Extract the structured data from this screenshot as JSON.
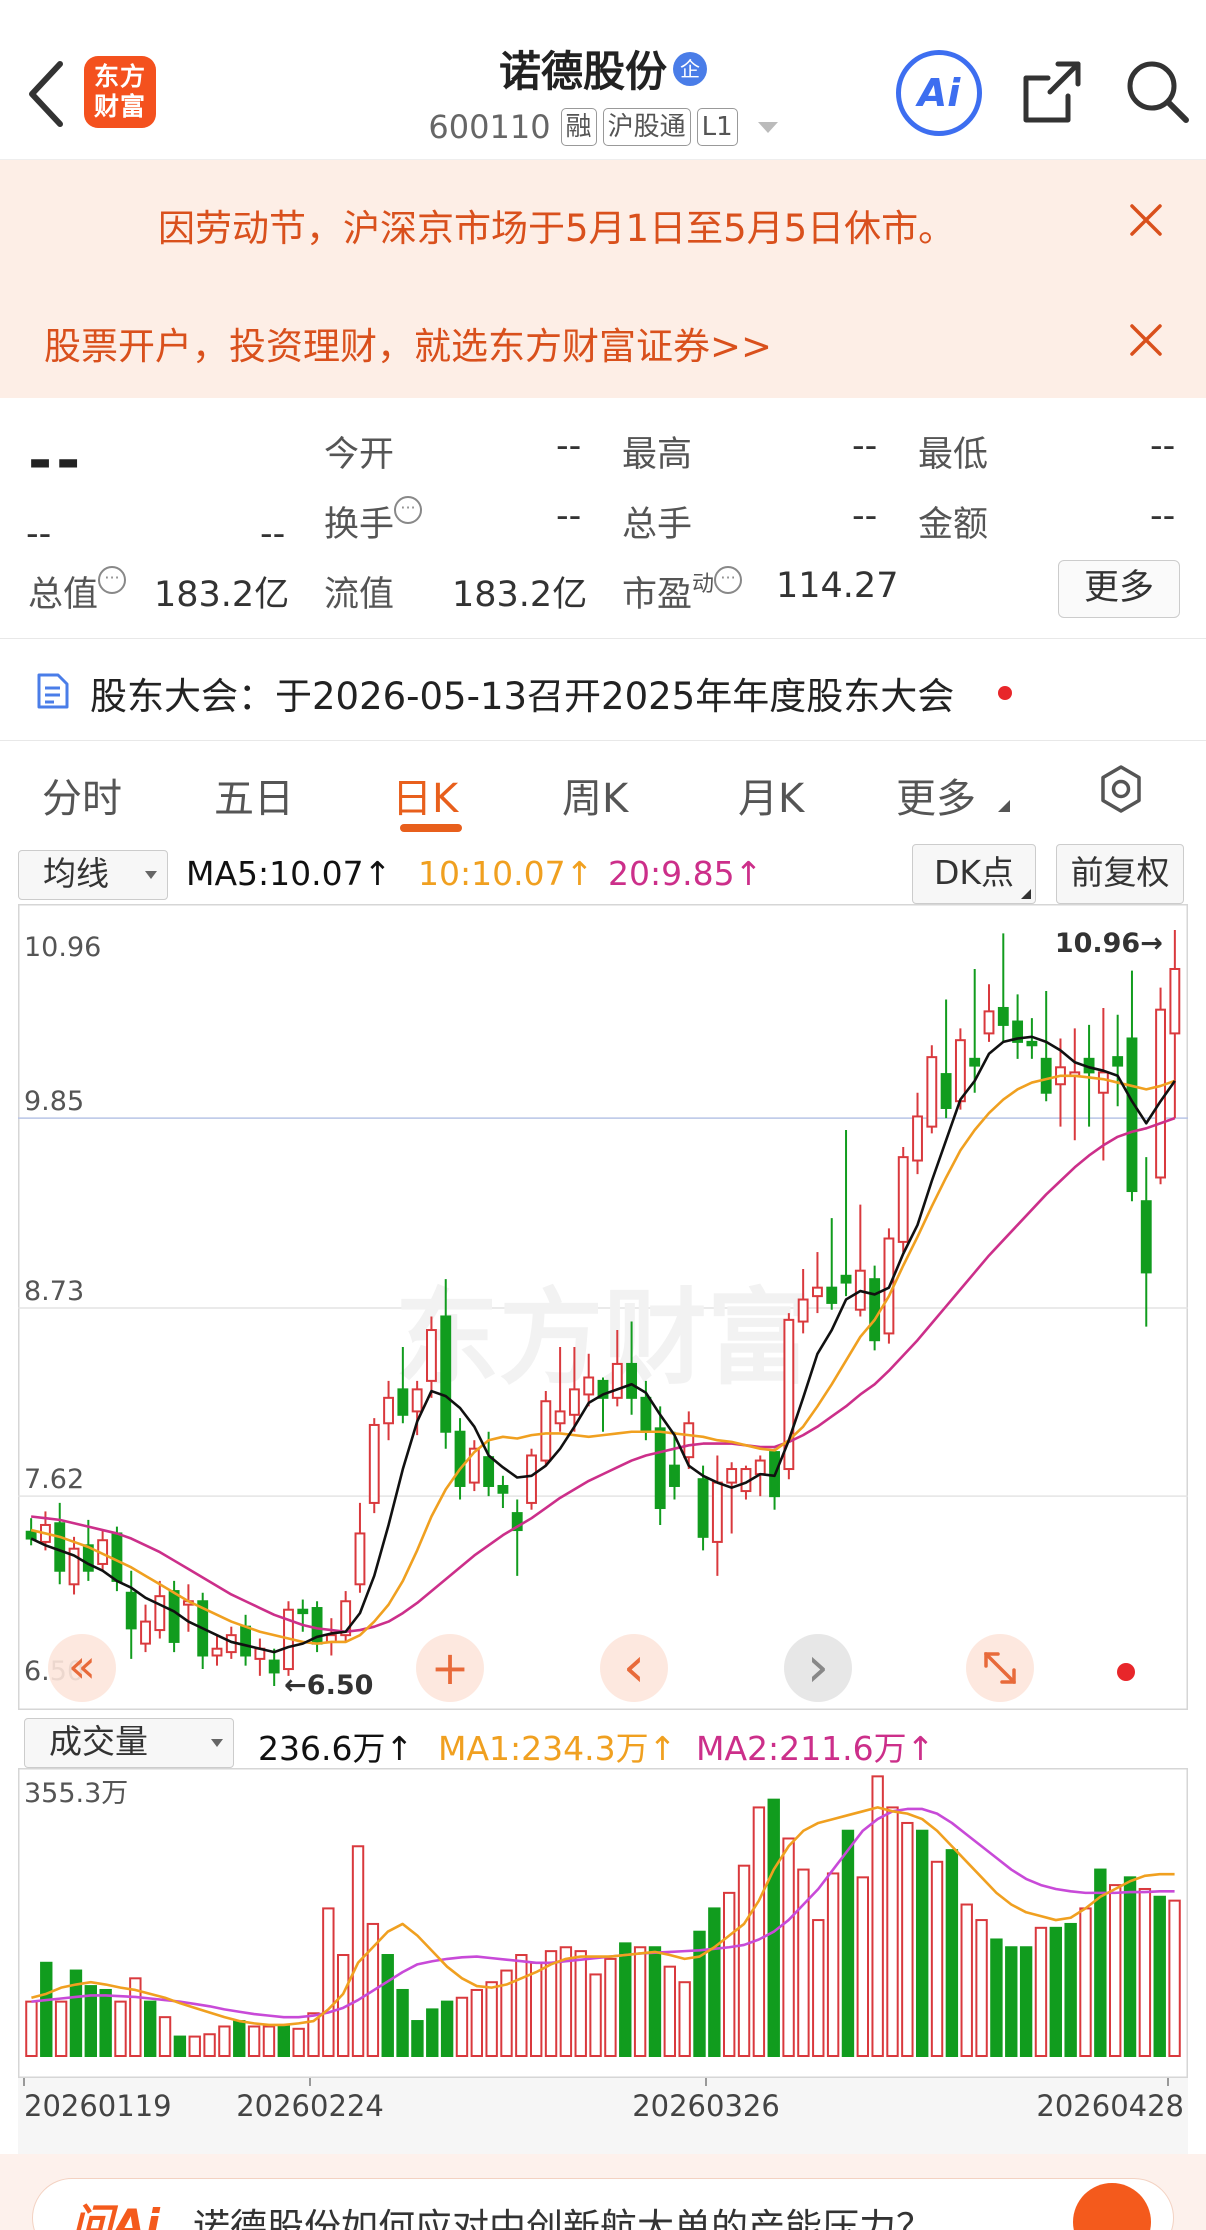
{
  "header": {
    "logo_text_1": "东方",
    "logo_text_2": "财富",
    "title": "诺德股份",
    "title_badge": "企",
    "code": "600110",
    "tags": [
      "融",
      "沪股通",
      "L1"
    ],
    "ai_label": "Ai"
  },
  "notices": [
    {
      "text": "因劳动节，沪深京市场于5月1日至5月5日休市。"
    },
    {
      "text": "股票开户，投资理财，就选东方财富证券>>"
    }
  ],
  "quote": {
    "price": "--",
    "change": "--",
    "change_pct": "--",
    "open_label": "今开",
    "open": "--",
    "high_label": "最高",
    "high": "--",
    "low_label": "最低",
    "low": "--",
    "turnover_label": "换手",
    "turnover": "--",
    "volume_label": "总手",
    "volume": "--",
    "amount_label": "金额",
    "amount": "--",
    "mktcap_label": "总值",
    "mktcap": "183.2亿",
    "float_label": "流值",
    "float_cap": "183.2亿",
    "pe_label": "市盈",
    "pe_sup": "动",
    "pe": "114.27",
    "more_label": "更多"
  },
  "meeting": {
    "text": "股东大会：于2026-05-13召开2025年年度股东大会"
  },
  "tabs": [
    "分时",
    "五日",
    "日K",
    "周K",
    "月K",
    "更多"
  ],
  "active_tab": "日K",
  "chart_controls": {
    "ma_selector": "均线",
    "ma5": "MA5:10.07",
    "ma10": "10:10.07",
    "ma20": "20:9.85",
    "dk_label": "DK点",
    "adjust_label": "前复权",
    "vol_selector": "成交量",
    "vol_value": "236.6万",
    "vol_ma1": "MA1:234.3万",
    "vol_ma2": "MA2:211.6万",
    "arrow_up": "↑"
  },
  "colors": {
    "up": "#d9393d",
    "down": "#119c1e",
    "ma5": "#111111",
    "ma10": "#f0a020",
    "ma20": "#cc2f8a",
    "accent": "#e85f1c"
  },
  "chart_data": [
    {
      "type": "candlestick",
      "title": "",
      "y_ticks": [
        "10.96",
        "9.85",
        "8.73",
        "7.62",
        "6.50"
      ],
      "ylim": [
        6.5,
        10.96
      ],
      "high_marker": "10.96→",
      "low_marker": "←6.50",
      "candles": [
        [
          7.41,
          7.37,
          7.49,
          7.33
        ],
        [
          7.35,
          7.45,
          7.53,
          7.3
        ],
        [
          7.46,
          7.18,
          7.58,
          7.1
        ],
        [
          7.1,
          7.31,
          7.38,
          7.04
        ],
        [
          7.33,
          7.18,
          7.48,
          7.12
        ],
        [
          7.22,
          7.36,
          7.42,
          7.18
        ],
        [
          7.4,
          7.12,
          7.44,
          7.06
        ],
        [
          7.05,
          6.84,
          7.18,
          6.66
        ],
        [
          6.75,
          6.88,
          6.98,
          6.7
        ],
        [
          6.83,
          7.03,
          7.12,
          6.78
        ],
        [
          7.06,
          6.76,
          7.12,
          6.7
        ],
        [
          6.98,
          7.0,
          7.1,
          6.82
        ],
        [
          7.0,
          6.68,
          7.05,
          6.6
        ],
        [
          6.68,
          6.72,
          6.8,
          6.62
        ],
        [
          6.7,
          6.8,
          6.85,
          6.66
        ],
        [
          6.85,
          6.68,
          6.92,
          6.62
        ],
        [
          6.66,
          6.72,
          6.78,
          6.56
        ],
        [
          6.65,
          6.58,
          6.72,
          6.5
        ],
        [
          6.6,
          6.95,
          7.0,
          6.56
        ],
        [
          6.95,
          6.93,
          7.01,
          6.82
        ],
        [
          6.96,
          6.75,
          7.0,
          6.7
        ],
        [
          6.76,
          6.8,
          6.9,
          6.68
        ],
        [
          6.8,
          7.0,
          7.06,
          6.76
        ],
        [
          7.1,
          7.4,
          7.58,
          7.05
        ],
        [
          7.58,
          8.04,
          8.08,
          7.52
        ],
        [
          8.05,
          8.2,
          8.3,
          7.95
        ],
        [
          8.25,
          8.1,
          8.5,
          8.05
        ],
        [
          8.12,
          8.25,
          8.3,
          7.98
        ],
        [
          8.3,
          8.6,
          8.68,
          8.2
        ],
        [
          8.68,
          8.0,
          8.9,
          7.9
        ],
        [
          8.0,
          7.68,
          8.08,
          7.6
        ],
        [
          7.7,
          7.9,
          7.95,
          7.65
        ],
        [
          7.85,
          7.68,
          8.0,
          7.62
        ],
        [
          7.68,
          7.64,
          7.74,
          7.55
        ],
        [
          7.52,
          7.42,
          7.6,
          7.15
        ],
        [
          7.58,
          7.86,
          7.9,
          7.54
        ],
        [
          7.83,
          8.18,
          8.24,
          7.8
        ],
        [
          8.05,
          8.12,
          8.5,
          8.0
        ],
        [
          8.1,
          8.25,
          8.5,
          8.0
        ],
        [
          8.22,
          8.32,
          8.46,
          8.15
        ],
        [
          8.3,
          8.2,
          8.32,
          8.0
        ],
        [
          8.2,
          8.4,
          8.6,
          8.15
        ],
        [
          8.4,
          8.2,
          8.65,
          8.1
        ],
        [
          8.2,
          8.0,
          8.3,
          7.95
        ],
        [
          8.02,
          7.55,
          8.15,
          7.45
        ],
        [
          7.8,
          7.68,
          8.0,
          7.6
        ],
        [
          7.85,
          8.05,
          8.12,
          7.78
        ],
        [
          7.72,
          7.38,
          7.8,
          7.3
        ],
        [
          7.35,
          7.7,
          7.86,
          7.15
        ],
        [
          7.7,
          7.78,
          7.82,
          7.4
        ],
        [
          7.65,
          7.78,
          7.8,
          7.6
        ],
        [
          7.75,
          7.83,
          7.86,
          7.62
        ],
        [
          7.88,
          7.62,
          7.9,
          7.54
        ],
        [
          7.78,
          8.66,
          8.7,
          7.72
        ],
        [
          8.65,
          8.78,
          8.96,
          8.58
        ],
        [
          8.8,
          8.85,
          9.06,
          8.7
        ],
        [
          8.85,
          8.76,
          9.26,
          8.72
        ],
        [
          8.92,
          8.88,
          9.78,
          8.8
        ],
        [
          8.72,
          8.95,
          9.34,
          8.68
        ],
        [
          8.9,
          8.54,
          8.98,
          8.48
        ],
        [
          8.58,
          9.14,
          9.2,
          8.52
        ],
        [
          9.12,
          9.62,
          9.68,
          9.06
        ],
        [
          9.6,
          9.86,
          10.0,
          9.52
        ],
        [
          9.8,
          10.21,
          10.28,
          9.76
        ],
        [
          10.11,
          9.91,
          10.55,
          9.85
        ],
        [
          9.95,
          10.31,
          10.38,
          9.9
        ],
        [
          10.2,
          10.16,
          10.73,
          10.0
        ],
        [
          10.35,
          10.48,
          10.64,
          10.3
        ],
        [
          10.5,
          10.4,
          10.94,
          10.3
        ],
        [
          10.42,
          10.3,
          10.58,
          10.2
        ],
        [
          10.3,
          10.28,
          10.44,
          10.2
        ],
        [
          10.2,
          10.0,
          10.6,
          9.95
        ],
        [
          10.05,
          10.15,
          10.32,
          9.8
        ],
        [
          10.1,
          10.12,
          10.38,
          9.72
        ],
        [
          10.2,
          10.12,
          10.4,
          9.8
        ],
        [
          10.0,
          10.12,
          10.5,
          9.6
        ],
        [
          10.21,
          10.16,
          10.46,
          9.92
        ],
        [
          10.32,
          9.42,
          10.72,
          9.36
        ],
        [
          9.36,
          8.94,
          9.62,
          8.62
        ],
        [
          9.5,
          10.49,
          10.62,
          9.46
        ],
        [
          10.35,
          10.73,
          10.96,
          9.85
        ]
      ],
      "ma5": [
        7.37,
        7.33,
        7.3,
        7.27,
        7.22,
        7.18,
        7.12,
        7.08,
        7.02,
        6.98,
        6.94,
        6.88,
        6.84,
        6.8,
        6.76,
        6.74,
        6.72,
        6.7,
        6.73,
        6.75,
        6.79,
        6.81,
        6.82,
        6.93,
        7.15,
        7.45,
        7.78,
        8.06,
        8.24,
        8.21,
        8.14,
        8.03,
        7.86,
        7.79,
        7.73,
        7.74,
        7.8,
        7.9,
        8.03,
        8.17,
        8.22,
        8.25,
        8.28,
        8.23,
        8.1,
        7.98,
        7.8,
        7.74,
        7.7,
        7.67,
        7.7,
        7.75,
        7.74,
        7.95,
        8.2,
        8.46,
        8.6,
        8.78,
        8.83,
        8.81,
        8.85,
        9.05,
        9.22,
        9.48,
        9.72,
        9.96,
        10.07,
        10.23,
        10.3,
        10.32,
        10.33,
        10.3,
        10.25,
        10.18,
        10.15,
        10.13,
        10.1,
        9.95,
        9.82,
        9.95,
        10.07
      ],
      "ma10": [
        7.42,
        7.4,
        7.38,
        7.35,
        7.32,
        7.28,
        7.24,
        7.2,
        7.15,
        7.1,
        7.05,
        7.0,
        6.96,
        6.92,
        6.88,
        6.85,
        6.82,
        6.8,
        6.78,
        6.76,
        6.75,
        6.76,
        6.76,
        6.8,
        6.88,
        6.98,
        7.12,
        7.3,
        7.5,
        7.66,
        7.78,
        7.88,
        7.95,
        7.97,
        7.96,
        7.98,
        7.99,
        7.99,
        7.98,
        7.97,
        7.98,
        7.99,
        8.0,
        8.0,
        8.0,
        7.99,
        7.98,
        7.97,
        7.95,
        7.94,
        7.92,
        7.9,
        7.89,
        7.95,
        8.03,
        8.15,
        8.28,
        8.42,
        8.56,
        8.66,
        8.8,
        8.98,
        9.15,
        9.33,
        9.5,
        9.66,
        9.78,
        9.88,
        9.96,
        10.02,
        10.06,
        10.08,
        10.1,
        10.1,
        10.09,
        10.08,
        10.06,
        10.04,
        10.02,
        10.04,
        10.07
      ],
      "ma20": [
        7.5,
        7.49,
        7.48,
        7.46,
        7.44,
        7.42,
        7.4,
        7.37,
        7.33,
        7.29,
        7.24,
        7.19,
        7.14,
        7.09,
        7.04,
        7.0,
        6.96,
        6.92,
        6.89,
        6.86,
        6.84,
        6.83,
        6.82,
        6.83,
        6.85,
        6.88,
        6.93,
        6.99,
        7.06,
        7.13,
        7.2,
        7.27,
        7.33,
        7.39,
        7.44,
        7.49,
        7.55,
        7.61,
        7.66,
        7.71,
        7.75,
        7.79,
        7.83,
        7.86,
        7.88,
        7.9,
        7.92,
        7.93,
        7.93,
        7.93,
        7.92,
        7.91,
        7.91,
        7.94,
        7.98,
        8.03,
        8.09,
        8.15,
        8.22,
        8.28,
        8.36,
        8.45,
        8.54,
        8.64,
        8.74,
        8.84,
        8.94,
        9.04,
        9.13,
        9.22,
        9.31,
        9.4,
        9.48,
        9.56,
        9.63,
        9.69,
        9.74,
        9.77,
        9.79,
        9.82,
        9.85
      ]
    },
    {
      "type": "bar",
      "title": "",
      "y_ticks": [
        "355.3万"
      ],
      "ymax": 355.3,
      "x_ticks": [
        "20260119",
        "20260224",
        "20260326",
        "20260428"
      ],
      "values": [
        70,
        120,
        70,
        110,
        90,
        85,
        70,
        100,
        70,
        50,
        25,
        25,
        28,
        38,
        45,
        38,
        38,
        38,
        35,
        55,
        190,
        130,
        270,
        170,
        130,
        85,
        45,
        60,
        70,
        75,
        85,
        95,
        110,
        130,
        120,
        135,
        140,
        135,
        105,
        125,
        145,
        140,
        140,
        115,
        95,
        160,
        190,
        210,
        245,
        320,
        330,
        280,
        240,
        175,
        235,
        290,
        230,
        360,
        320,
        300,
        290,
        250,
        265,
        195,
        175,
        150,
        140,
        140,
        165,
        165,
        170,
        190,
        240,
        220,
        230,
        215,
        205,
        200
      ],
      "colors_up_down": "u,d,u,d,d,d,u,u,d,u,d,u,u,u,d,u,u,d,u,u,u,u,u,u,d,d,d,d,d,u,u,u,u,u,u,u,u,u,u,u,d,u,d,u,u,d,d,u,u,u,d,u,u,u,u,d,u,u,u,u,d,u,d,u,u,d,d,d,u,d,d,u,d,u,d,u,d,u",
      "ma1": [
        75,
        80,
        88,
        92,
        95,
        92,
        88,
        85,
        80,
        75,
        68,
        62,
        56,
        50,
        45,
        42,
        40,
        40,
        42,
        45,
        60,
        80,
        120,
        140,
        160,
        170,
        155,
        135,
        115,
        100,
        90,
        88,
        92,
        100,
        108,
        118,
        125,
        128,
        128,
        128,
        130,
        132,
        134,
        130,
        125,
        128,
        140,
        155,
        170,
        200,
        240,
        270,
        290,
        300,
        305,
        310,
        315,
        320,
        315,
        312,
        305,
        290,
        270,
        250,
        230,
        210,
        195,
        185,
        180,
        175,
        178,
        190,
        205,
        215,
        225,
        232,
        234,
        234
      ],
      "ma2": [
        70,
        72,
        74,
        76,
        78,
        78,
        77,
        76,
        74,
        72,
        70,
        67,
        64,
        60,
        57,
        54,
        52,
        50,
        50,
        52,
        56,
        62,
        72,
        84,
        96,
        108,
        118,
        122,
        125,
        127,
        128,
        126,
        124,
        122,
        120,
        120,
        122,
        124,
        126,
        128,
        130,
        132,
        133,
        134,
        135,
        136,
        138,
        140,
        143,
        150,
        160,
        175,
        195,
        215,
        240,
        265,
        290,
        305,
        315,
        318,
        318,
        312,
        300,
        285,
        270,
        255,
        240,
        228,
        220,
        215,
        212,
        210,
        210,
        210,
        211,
        211,
        212,
        212
      ]
    }
  ],
  "chart_buttons": {
    "rewind": "«",
    "add": "+",
    "prev": "‹",
    "next": "›"
  },
  "ai_banner": {
    "logo": "问Ai",
    "text": "诺德股份如何应对中创新航大单的产能压力？"
  }
}
